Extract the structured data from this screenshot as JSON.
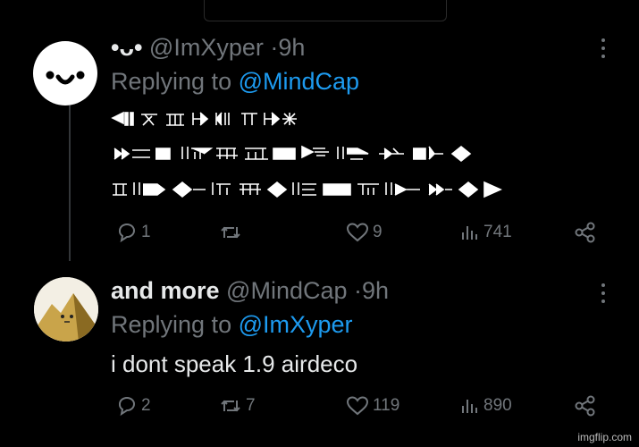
{
  "posts": [
    {
      "display_name": "•ᴗ•",
      "handle": "@ImXyper",
      "time": "9h",
      "replying_prefix": "Replying to",
      "replying_to": "@MindCap",
      "content_type": "cuneiform-script",
      "actions": {
        "replies": "1",
        "reposts": "",
        "likes": "9",
        "views": "741"
      }
    },
    {
      "display_name": "and more",
      "handle": "@MindCap",
      "time": "9h",
      "replying_prefix": "Replying to",
      "replying_to": "@ImXyper",
      "text": "i dont speak 1.9 airdeco",
      "actions": {
        "replies": "2",
        "reposts": "7",
        "likes": "119",
        "views": "890"
      }
    }
  ],
  "watermark": "imgflip.com",
  "icons": [
    "reply-icon",
    "repost-icon",
    "like-icon",
    "views-icon",
    "share-icon",
    "more-icon"
  ],
  "colors": {
    "background": "#000000",
    "text": "#e7e9ea",
    "muted": "#71767b",
    "link": "#1d9bf0"
  }
}
